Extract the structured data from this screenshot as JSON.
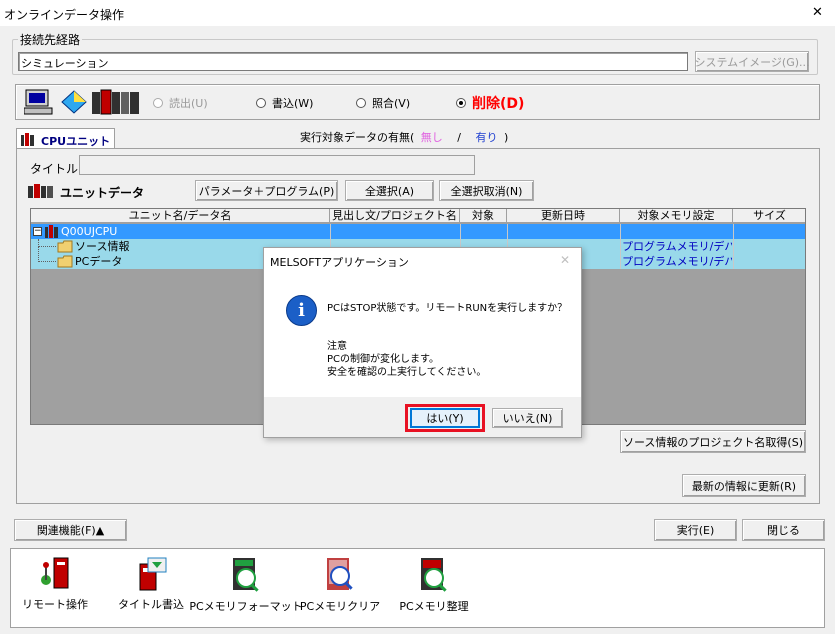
{
  "window": {
    "title": "オンラインデータ操作",
    "close_glyph": "✕"
  },
  "connection": {
    "label": "接続先経路",
    "value": "シミュレーション",
    "system_image_button": "システムイメージ(G)..."
  },
  "operations": {
    "read": "読出(U)",
    "write": "書込(W)",
    "verify": "照合(V)",
    "delete": "削除(D)",
    "selected": "delete"
  },
  "tab": {
    "label": "CPUユニット"
  },
  "target_presence": {
    "prefix": "実行対象データの有無(",
    "none": "無し",
    "sep": "/",
    "exists": "有り",
    "suffix": ")"
  },
  "title_field": {
    "label": "タイトル",
    "value": ""
  },
  "unit_data": {
    "label": "ユニットデータ",
    "param_program_button": "パラメータ＋プログラム(P)",
    "select_all_button": "全選択(A)",
    "deselect_all_button": "全選択取消(N)"
  },
  "table": {
    "columns": [
      "ユニット名/データ名",
      "見出し文/プロジェクト名",
      "対象",
      "更新日時",
      "対象メモリ設定",
      "サイズ"
    ],
    "rows": [
      {
        "name": "Q00UJCPU",
        "memory": "",
        "expander": "−"
      },
      {
        "name": "ソース情報",
        "memory": "プログラムメモリ/デバ..."
      },
      {
        "name": "PCデータ",
        "memory": "プログラムメモリ/デバ..."
      }
    ]
  },
  "dialog": {
    "title": "MELSOFTアプリケーション",
    "close_glyph": "✕",
    "info_glyph": "i",
    "message": "PCはSTOP状態です。リモートRUNを実行しますか？",
    "note_title": "注意",
    "note_line1": "PCの制御が変化します。",
    "note_line2": "安全を確認の上実行してください。",
    "yes_button": "はい(Y)",
    "no_button": "いいえ(N)"
  },
  "side_buttons": {
    "get_project_name": "ソース情報のプロジェクト名取得(S)",
    "refresh": "最新の情報に更新(R)"
  },
  "bottom": {
    "related_functions": "関連機能(F)▲",
    "execute": "実行(E)",
    "close": "閉じる"
  },
  "function_icons": [
    {
      "label": "リモート操作"
    },
    {
      "label": "タイトル書込"
    },
    {
      "label": "PCメモリフォーマット"
    },
    {
      "label": "PCメモリクリア"
    },
    {
      "label": "PCメモリ整理"
    }
  ],
  "colors": {
    "selection": "#3399ff",
    "row_highlight": "#99d9ea",
    "delete_red": "#ff0000",
    "none_pink": "#e060e0",
    "exists_blue": "#2040d0",
    "highlight_frame": "#e81123",
    "memory_text": "#0000c0"
  }
}
